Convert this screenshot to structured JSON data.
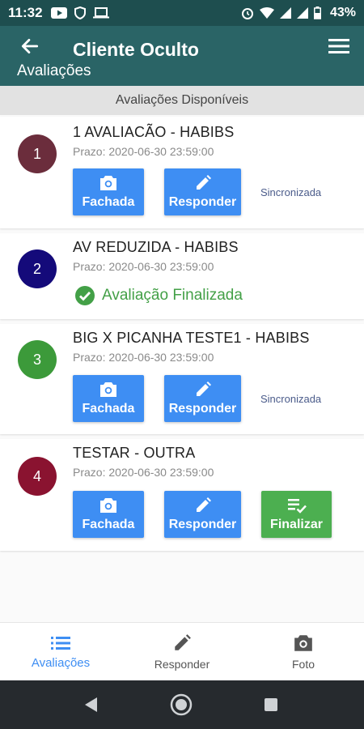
{
  "status_bar": {
    "time": "11:32",
    "battery_percent": "43%",
    "icons_left": [
      "youtube-icon",
      "shield-icon",
      "laptop-icon"
    ],
    "icons_right": [
      "alarm-icon",
      "wifi-icon",
      "signal-icon",
      "signal-icon",
      "battery-icon"
    ]
  },
  "app_bar": {
    "title": "Cliente Oculto",
    "subtitle": "Avaliações",
    "back_icon": "arrow-left-icon",
    "menu_icon": "menu-icon",
    "background_color": "#2a6466"
  },
  "section": {
    "header": "Avaliações Disponíveis"
  },
  "evaluations": [
    {
      "number": "1",
      "title": "1 AVALIACÃO - HABIBS",
      "deadline": "Prazo: 2020-06-30 23:59:00",
      "color": "#6b2d3c",
      "buttons": {
        "photo_label": "Fachada",
        "respond_label": "Responder"
      },
      "status": "Sincronizada"
    },
    {
      "number": "2",
      "title": "AV REDUZIDA - HABIBS",
      "deadline": "Prazo: 2020-06-30 23:59:00",
      "color": "#140a7a",
      "finished_label": "Avaliação Finalizada"
    },
    {
      "number": "3",
      "title": "BIG X PICANHA TESTE1 - HABIBS",
      "deadline": "Prazo: 2020-06-30 23:59:00",
      "color": "#3c9a3a",
      "buttons": {
        "photo_label": "Fachada",
        "respond_label": "Responder"
      },
      "status": "Sincronizada"
    },
    {
      "number": "4",
      "title": "TESTAR - OUTRA",
      "deadline": "Prazo: 2020-06-30 23:59:00",
      "color": "#8a1330",
      "buttons": {
        "photo_label": "Fachada",
        "respond_label": "Responder",
        "finish_label": "Finalizar"
      }
    }
  ],
  "bottom_nav": [
    {
      "label": "Avaliações",
      "icon": "list-icon",
      "active": true
    },
    {
      "label": "Responder",
      "icon": "pencil-icon",
      "active": false
    },
    {
      "label": "Foto",
      "icon": "camera-icon",
      "active": false
    }
  ],
  "colors": {
    "primary_button": "#3e8ef3",
    "finish_button": "#4caf50",
    "finished_text": "#43a047"
  },
  "system_nav": [
    "back-triangle-icon",
    "home-circle-icon",
    "recents-square-icon"
  ]
}
